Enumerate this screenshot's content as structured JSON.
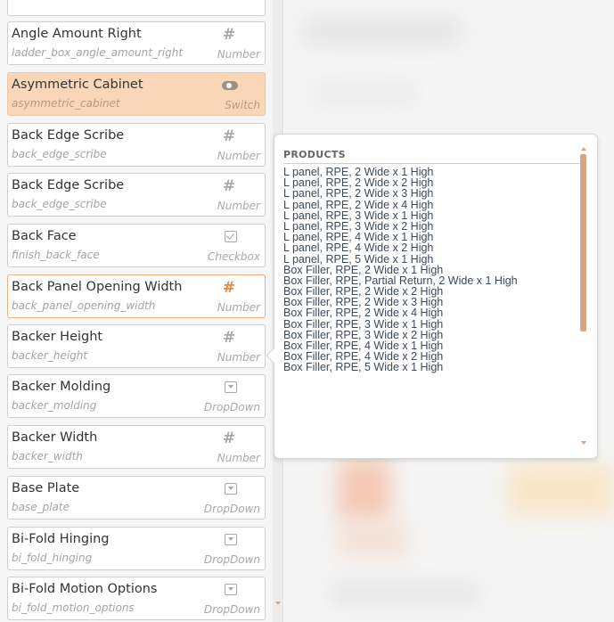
{
  "properties": [
    {
      "label": "Angle Amount Right",
      "key": "ladder_box_angle_amount_right",
      "type": "Number",
      "icon": "hash-icon"
    },
    {
      "label": "Asymmetric Cabinet",
      "key": "asymmetric_cabinet",
      "type": "Switch",
      "icon": "toggle-switch-icon",
      "selected": true
    },
    {
      "label": "Back Edge Scribe",
      "key": "back_edge_scribe",
      "type": "Number",
      "icon": "hash-icon"
    },
    {
      "label": "Back Edge Scribe",
      "key": "back_edge_scribe",
      "type": "Number",
      "icon": "hash-icon"
    },
    {
      "label": "Back Face",
      "key": "finish_back_face",
      "type": "Checkbox",
      "icon": "checkbox-icon"
    },
    {
      "label": "Back Panel Opening Width",
      "key": "back_panel_opening_width",
      "type": "Number",
      "icon": "hash-icon",
      "active": true
    },
    {
      "label": "Backer Height",
      "key": "backer_height",
      "type": "Number",
      "icon": "hash-icon"
    },
    {
      "label": "Backer Molding",
      "key": "backer_molding",
      "type": "DropDown",
      "icon": "dropdown-icon"
    },
    {
      "label": "Backer Width",
      "key": "backer_width",
      "type": "Number",
      "icon": "hash-icon"
    },
    {
      "label": "Base Plate",
      "key": "base_plate",
      "type": "DropDown",
      "icon": "dropdown-icon"
    },
    {
      "label": "Bi-Fold Hinging",
      "key": "bi_fold_hinging",
      "type": "DropDown",
      "icon": "dropdown-icon"
    },
    {
      "label": "Bi-Fold Motion Options",
      "key": "bi_fold_motion_options",
      "type": "DropDown",
      "icon": "dropdown-icon"
    }
  ],
  "popup": {
    "heading": "PRODUCTS",
    "items": [
      "L panel, RPE, 2 Wide x 1 High",
      "L panel, RPE, 2 Wide x 2 High",
      "L panel, RPE, 2 Wide x 3 High",
      "L panel, RPE, 2 Wide x 4 High",
      "L panel, RPE, 3 Wide x 1 High",
      "L panel, RPE, 3 Wide x 2 High",
      "L panel, RPE, 4 Wide x 1 High",
      "L panel, RPE, 4 Wide x 2 High",
      "L panel, RPE, 5 Wide x 1 High",
      "Box Filler, RPE, 2 Wide x 1 High",
      "Box Filler, RPE, Partial Return, 2 Wide x 1 High",
      "Box Filler, RPE, 2 Wide x 2 High",
      "Box Filler, RPE, 2 Wide x 3 High",
      "Box Filler, RPE, 2 Wide x 4 High",
      "Box Filler, RPE, 3 Wide x 1 High",
      "Box Filler, RPE, 3 Wide x 2 High",
      "Box Filler, RPE, 4 Wide x 1 High",
      "Box Filler, RPE, 4 Wide x 2 High",
      "Box Filler, RPE, 5 Wide x 1 High"
    ]
  },
  "colors": {
    "accent": "#e8883a",
    "selected_bg": "#f9d6b8",
    "scroll_thumb": "#d6a882"
  }
}
